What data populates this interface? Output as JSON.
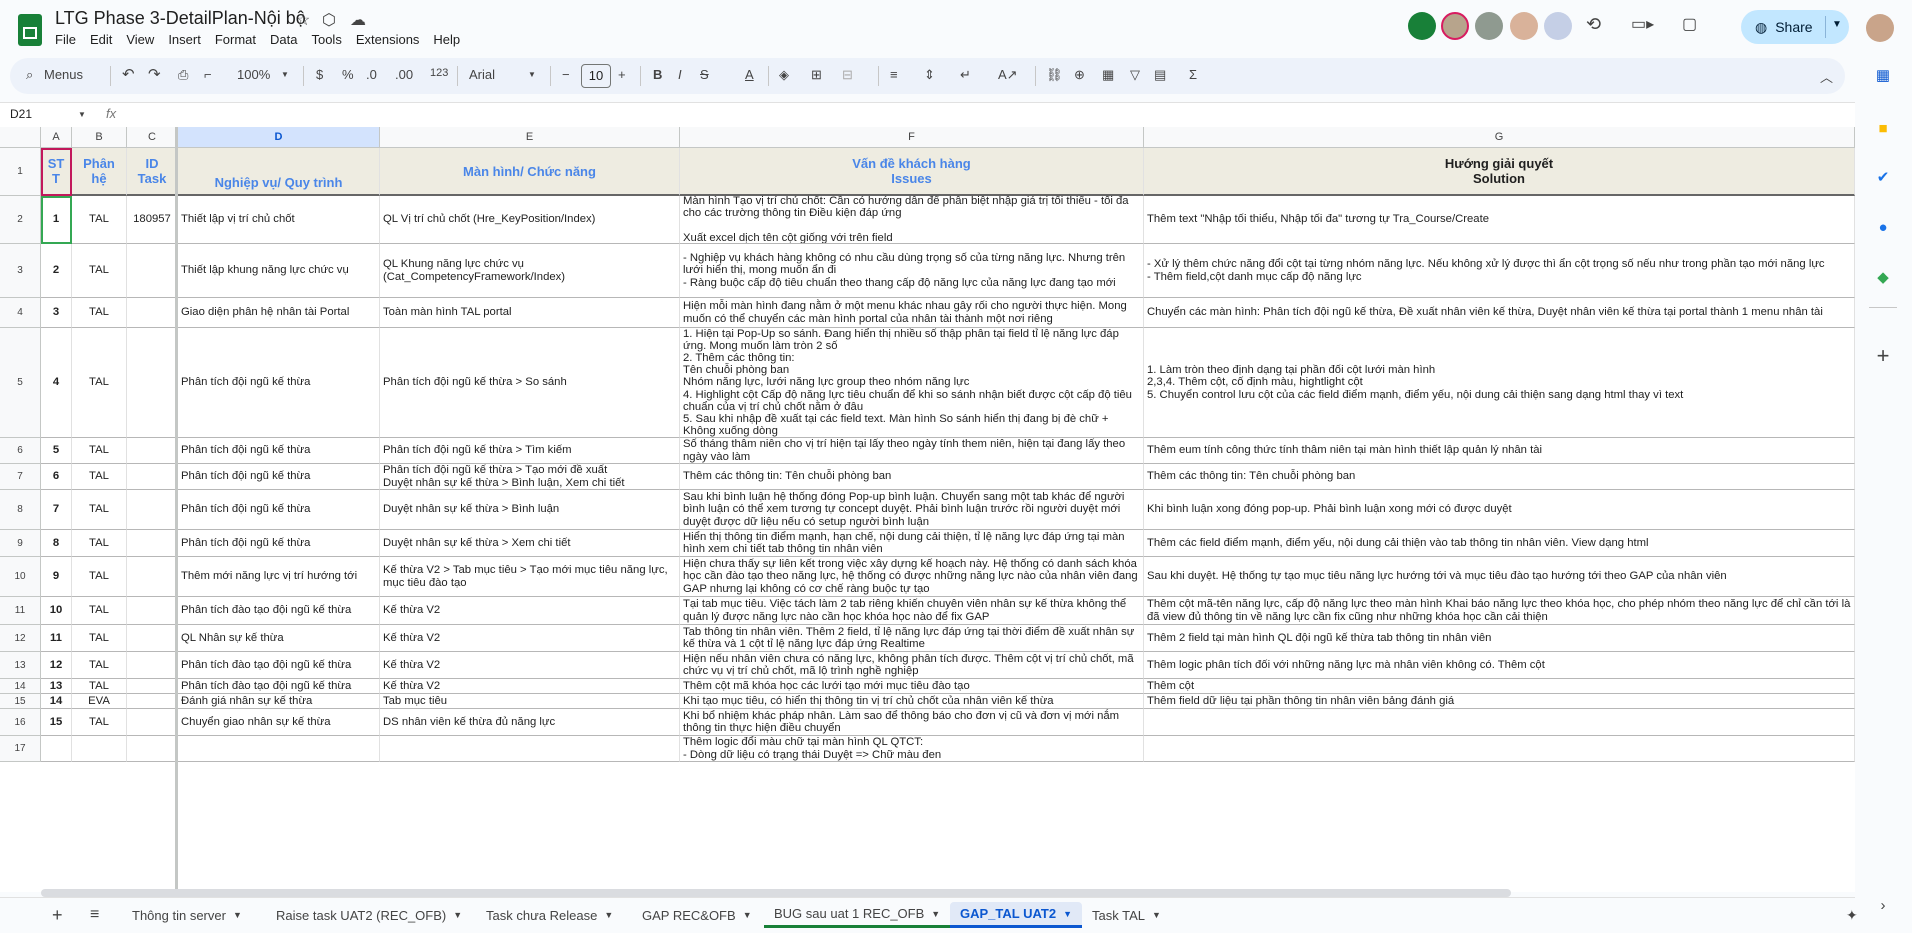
{
  "app": {
    "doc_title": "LTG Phase 3-DetailPlan-Nội bộ",
    "menu": [
      "File",
      "Edit",
      "View",
      "Insert",
      "Format",
      "Data",
      "Tools",
      "Extensions",
      "Help"
    ],
    "share_label": "Share"
  },
  "toolbar": {
    "menus_label": "Menus",
    "zoom": "100%",
    "currency": "$",
    "percent": "%",
    "dec_less": ".0",
    "dec_more": ".00",
    "number_format": "123",
    "font": "Arial",
    "font_size": "10"
  },
  "formula_bar": {
    "name_box": "D21",
    "fx": "fx",
    "value": ""
  },
  "columns": [
    "A",
    "B",
    "C",
    "D",
    "E",
    "F",
    "G"
  ],
  "header_row": {
    "stt": "ST\nT",
    "phan_he": "Phân\nhệ",
    "id_task": "ID\nTask",
    "nghiep_vu": "Nghiệp vụ/ Quy trình",
    "man_hinh": "Màn hình/ Chức năng",
    "van_de": "Vấn đề khách hàng\nIssues",
    "huong": "Hướng giải quyết\nSolution"
  },
  "row_numbers": [
    "1",
    "2",
    "3",
    "4",
    "5",
    "6",
    "7",
    "8",
    "9",
    "10",
    "11",
    "12",
    "13",
    "14",
    "15",
    "16",
    "17"
  ],
  "rows": [
    {
      "stt": "1",
      "phan_he": "TAL",
      "id": "180957",
      "nv": "Thiết lập vị trí chủ chốt",
      "mh": "QL Vị trí chủ chốt (Hre_KeyPosition/Index)",
      "vd": "Màn hình Tạo vị trí chủ chốt: Cần có hướng dẫn để phân biệt nhập giá trị tối thiểu - tối đa cho các trường thông tin Điều kiện đáp ứng\n\nXuất excel dịch tên cột giống với trên field",
      "hg": "Thêm text \"Nhập tối thiểu, Nhập tối đa\" tương tự Tra_Course/Create"
    },
    {
      "stt": "2",
      "phan_he": "TAL",
      "id": "",
      "nv": "Thiết lập khung năng lực chức vụ",
      "mh": "QL Khung năng lực chức vụ\n(Cat_CompetencyFramework/Index)",
      "vd": "- Nghiệp vụ khách hàng không có nhu cầu dùng trọng số của từng năng lực. Nhưng trên lưới hiển thị, mong muốn ẩn đi\n- Ràng buộc cấp độ tiêu chuẩn theo thang cấp độ năng lực của năng lực đang tạo mới",
      "hg": "- Xử lý thêm chức năng đổi cột tại từng nhóm năng lực. Nếu không xử lý được thì ẩn cột trọng số nếu như trong phần tạo mới năng lực\n- Thêm field,cột danh mục cấp độ năng lực"
    },
    {
      "stt": "3",
      "phan_he": "TAL",
      "id": "",
      "nv": "Giao diện phân hệ nhân tài Portal",
      "mh": "Toàn màn hình TAL portal",
      "vd": "Hiện mỗi màn hình đang nằm ở một menu khác nhau gây rối cho người thực hiện. Mong muốn có thể chuyển các màn hình portal của nhân tài thành một nơi riêng",
      "hg": "Chuyển các màn hình: Phân tích đội ngũ kế thừa, Đề xuất nhân viên kế thừa, Duyệt nhân viên kế thừa tại portal thành 1 menu nhân tài"
    },
    {
      "stt": "4",
      "phan_he": "TAL",
      "id": "",
      "nv": "Phân tích đội ngũ kế thừa",
      "mh": "Phân tích đội ngũ kế thừa > So sánh",
      "vd": "1. Hiện tại Pop-Up so sánh. Đang hiển thị nhiều số thập phân tại field tỉ lệ năng lực đáp ứng. Mong muốn làm tròn 2 số\n2. Thêm các thông tin:\nTên chuỗi phòng ban\nNhóm năng lực, lưới năng lực group theo nhóm năng lực\n4. Highlight cột Cấp độ năng lực tiêu chuẩn để khi so sánh nhận biết được cột cấp độ tiêu chuẩn của vị trí chủ chốt nằm ở đâu\n5. Sau khi nhập đề xuất tại các field text. Màn hình So sánh hiển thị đang bị đè chữ + Không xuống dòng",
      "hg": "1. Làm tròn theo định dạng tại phần đối cột lưới màn hình\n2,3,4. Thêm cột, cố định màu, hightlight cột\n5. Chuyển control lưu cột của các field điểm mạnh, điểm yếu, nội dung cải thiện sang dạng html thay vì text"
    },
    {
      "stt": "5",
      "phan_he": "TAL",
      "id": "",
      "nv": "Phân tích đội ngũ kế thừa",
      "mh": "Phân tích đội ngũ kế thừa > Tìm kiếm",
      "vd": "Số tháng thâm niên cho vị trí hiện tại lấy theo ngày tính them niên, hiện tại đang lấy theo ngày vào làm",
      "hg": "Thêm eum tính công thức tính thâm niên tại màn hình thiết lập quản lý nhân tài"
    },
    {
      "stt": "6",
      "phan_he": "TAL",
      "id": "",
      "nv": "Phân tích đội ngũ kế thừa",
      "mh": "Phân tích đội ngũ kế thừa > Tạo mới đề xuất\nDuyệt nhân sự kế thừa > Bình luận, Xem chi tiết",
      "vd": "Thêm các thông tin: Tên chuỗi phòng ban",
      "hg": "Thêm các thông tin: Tên chuỗi phòng ban"
    },
    {
      "stt": "7",
      "phan_he": "TAL",
      "id": "",
      "nv": "Phân tích đội ngũ kế thừa",
      "mh": "Duyệt nhân sự kế thừa > Bình luận",
      "vd": "Sau khi bình luận hệ thống đóng Pop-up bình luận. Chuyển sang một tab khác để người bình luận có thể xem tương tự concept duyệt. Phải bình luận trước rồi người duyệt mới duyệt được dữ liệu nếu có setup người bình luận",
      "hg": "Khi bình luận xong đóng pop-up. Phải bình luận xong mới có được duyệt"
    },
    {
      "stt": "8",
      "phan_he": "TAL",
      "id": "",
      "nv": "Phân tích đội ngũ kế thừa",
      "mh": "Duyệt nhân sự kế thừa > Xem chi tiết",
      "vd": "Hiển thị thông tin điểm mạnh, hạn chế, nội dung cải thiện, tỉ lệ năng lực đáp ứng tại màn hình xem chi tiết tab thông tin nhân viên",
      "hg": "Thêm các field điểm mạnh, điểm yếu, nội dung cải thiện vào tab thông tin nhân viên. View dạng html"
    },
    {
      "stt": "9",
      "phan_he": "TAL",
      "id": "",
      "nv": "Thêm mới năng lực vị trí hướng tới",
      "mh": "Kế thừa V2 > Tab mục tiêu > Tạo mới mục tiêu năng lực, mục tiêu đào tạo",
      "vd": "Hiện chưa thấy sự liên kết trong việc xây dựng kế hoạch này. Hệ thống có danh sách khóa học cần đào tạo theo năng lực, hệ thống có được những năng lực nào của nhân viên đang GAP nhưng lại không có cơ chế ràng buộc tự tạo",
      "hg": "Sau khi duyệt. Hệ thống tự tạo mục tiêu năng lực hướng tới và mục tiêu đào tạo hướng tới theo GAP của nhân viên"
    },
    {
      "stt": "10",
      "phan_he": "TAL",
      "id": "",
      "nv": "Phân tích đào tạo đội ngũ kế thừa",
      "mh": "Kế thừa V2",
      "vd": "Tại tab mục tiêu. Việc tách làm 2 tab riêng khiến chuyên viên nhân sự kế thừa không thể quản lý được năng lực nào cần học khóa học nào để fix GAP",
      "hg": "Thêm cột mã-tên năng lực, cấp độ năng lực theo màn hình Khai báo năng lực theo khóa học, cho phép nhóm theo năng lực để chỉ cần tới là đã view đủ thông tin về năng lực cần fix cũng như những khóa học cần cải thiện"
    },
    {
      "stt": "11",
      "phan_he": "TAL",
      "id": "",
      "nv": "QL Nhân sự kế thừa",
      "mh": "Kế thừa V2",
      "vd": "Tab thông tin nhân viên. Thêm 2 field, tỉ lệ năng lực đáp ứng tại thời điểm đề xuất nhân sự kế thừa và 1 cột tỉ lệ năng lực đáp ứng Realtime",
      "hg": "Thêm 2 field tại màn hình QL đội ngũ kế thừa tab thông tin nhân viên"
    },
    {
      "stt": "12",
      "phan_he": "TAL",
      "id": "",
      "nv": "Phân tích đào tạo đội ngũ kế thừa",
      "mh": "Kế thừa V2",
      "vd": "Hiện nếu nhân viên chưa có năng lực, không phân tích được. Thêm cột vị trí chủ chốt, mã chức vụ vị trí chủ chốt, mã lộ trình nghề nghiệp",
      "hg": "Thêm logic phân tích đối với những năng lực mà nhân viên không có. Thêm cột"
    },
    {
      "stt": "13",
      "phan_he": "TAL",
      "id": "",
      "nv": "Phân tích đào tạo đội ngũ kế thừa",
      "mh": "Kế thừa V2",
      "vd": "Thêm cột mã khóa học các lưới tạo mới mục tiêu đào tạo",
      "hg": "Thêm cột"
    },
    {
      "stt": "14",
      "phan_he": "EVA",
      "id": "",
      "nv": "Đánh giá nhân sự kế thừa",
      "mh": "Tab mục tiêu",
      "vd": "Khi tạo mục tiêu, có hiển thị thông tin vị trí chủ chốt của nhân viên kế thừa",
      "hg": "Thêm field dữ liệu tại phần thông tin nhân viên bảng đánh giá"
    },
    {
      "stt": "15",
      "phan_he": "TAL",
      "id": "",
      "nv": "Chuyển giao nhân sự kế thừa",
      "mh": "DS nhân viên kế thừa đủ năng lực",
      "vd": "Khi bổ nhiệm khác pháp nhân. Làm sao để thông báo cho đơn vị cũ và đơn vị mới nắm thông tin thực hiện điều chuyển",
      "hg": ""
    },
    {
      "stt": "",
      "phan_he": "",
      "id": "",
      "nv": "",
      "mh": "",
      "vd": "Thêm logic đổi màu chữ tại màn hình QL QTCT:\n- Dòng dữ liệu có trạng thái Duyệt => Chữ màu đen",
      "hg": ""
    }
  ],
  "tabs": [
    {
      "label": "Thông tin server"
    },
    {
      "label": "Raise task UAT2 (REC_OFB)"
    },
    {
      "label": "Task chưa Release"
    },
    {
      "label": "GAP REC&OFB"
    },
    {
      "label": "BUG sau uat 1 REC_OFB"
    },
    {
      "label": "GAP_TAL UAT2"
    },
    {
      "label": "Task TAL"
    }
  ],
  "active_tab": "GAP_TAL UAT2",
  "colors": {
    "accent": "#0b57d0",
    "header_fill": "#eeece1",
    "header_text": "#4a86e8",
    "share_bg": "#c2e7ff",
    "sheets_green": "#188038"
  },
  "icons": [
    "search-icon",
    "undo-icon",
    "redo-icon",
    "print-icon",
    "paint-format-icon",
    "fill-color-icon",
    "borders-icon",
    "merge-icon",
    "link-icon",
    "comment-icon",
    "chart-icon",
    "filter-icon",
    "functions-icon",
    "history-icon",
    "meet-icon",
    "globe-icon",
    "keep-icon",
    "tasks-icon",
    "contacts-icon",
    "maps-icon",
    "plus-icon"
  ]
}
